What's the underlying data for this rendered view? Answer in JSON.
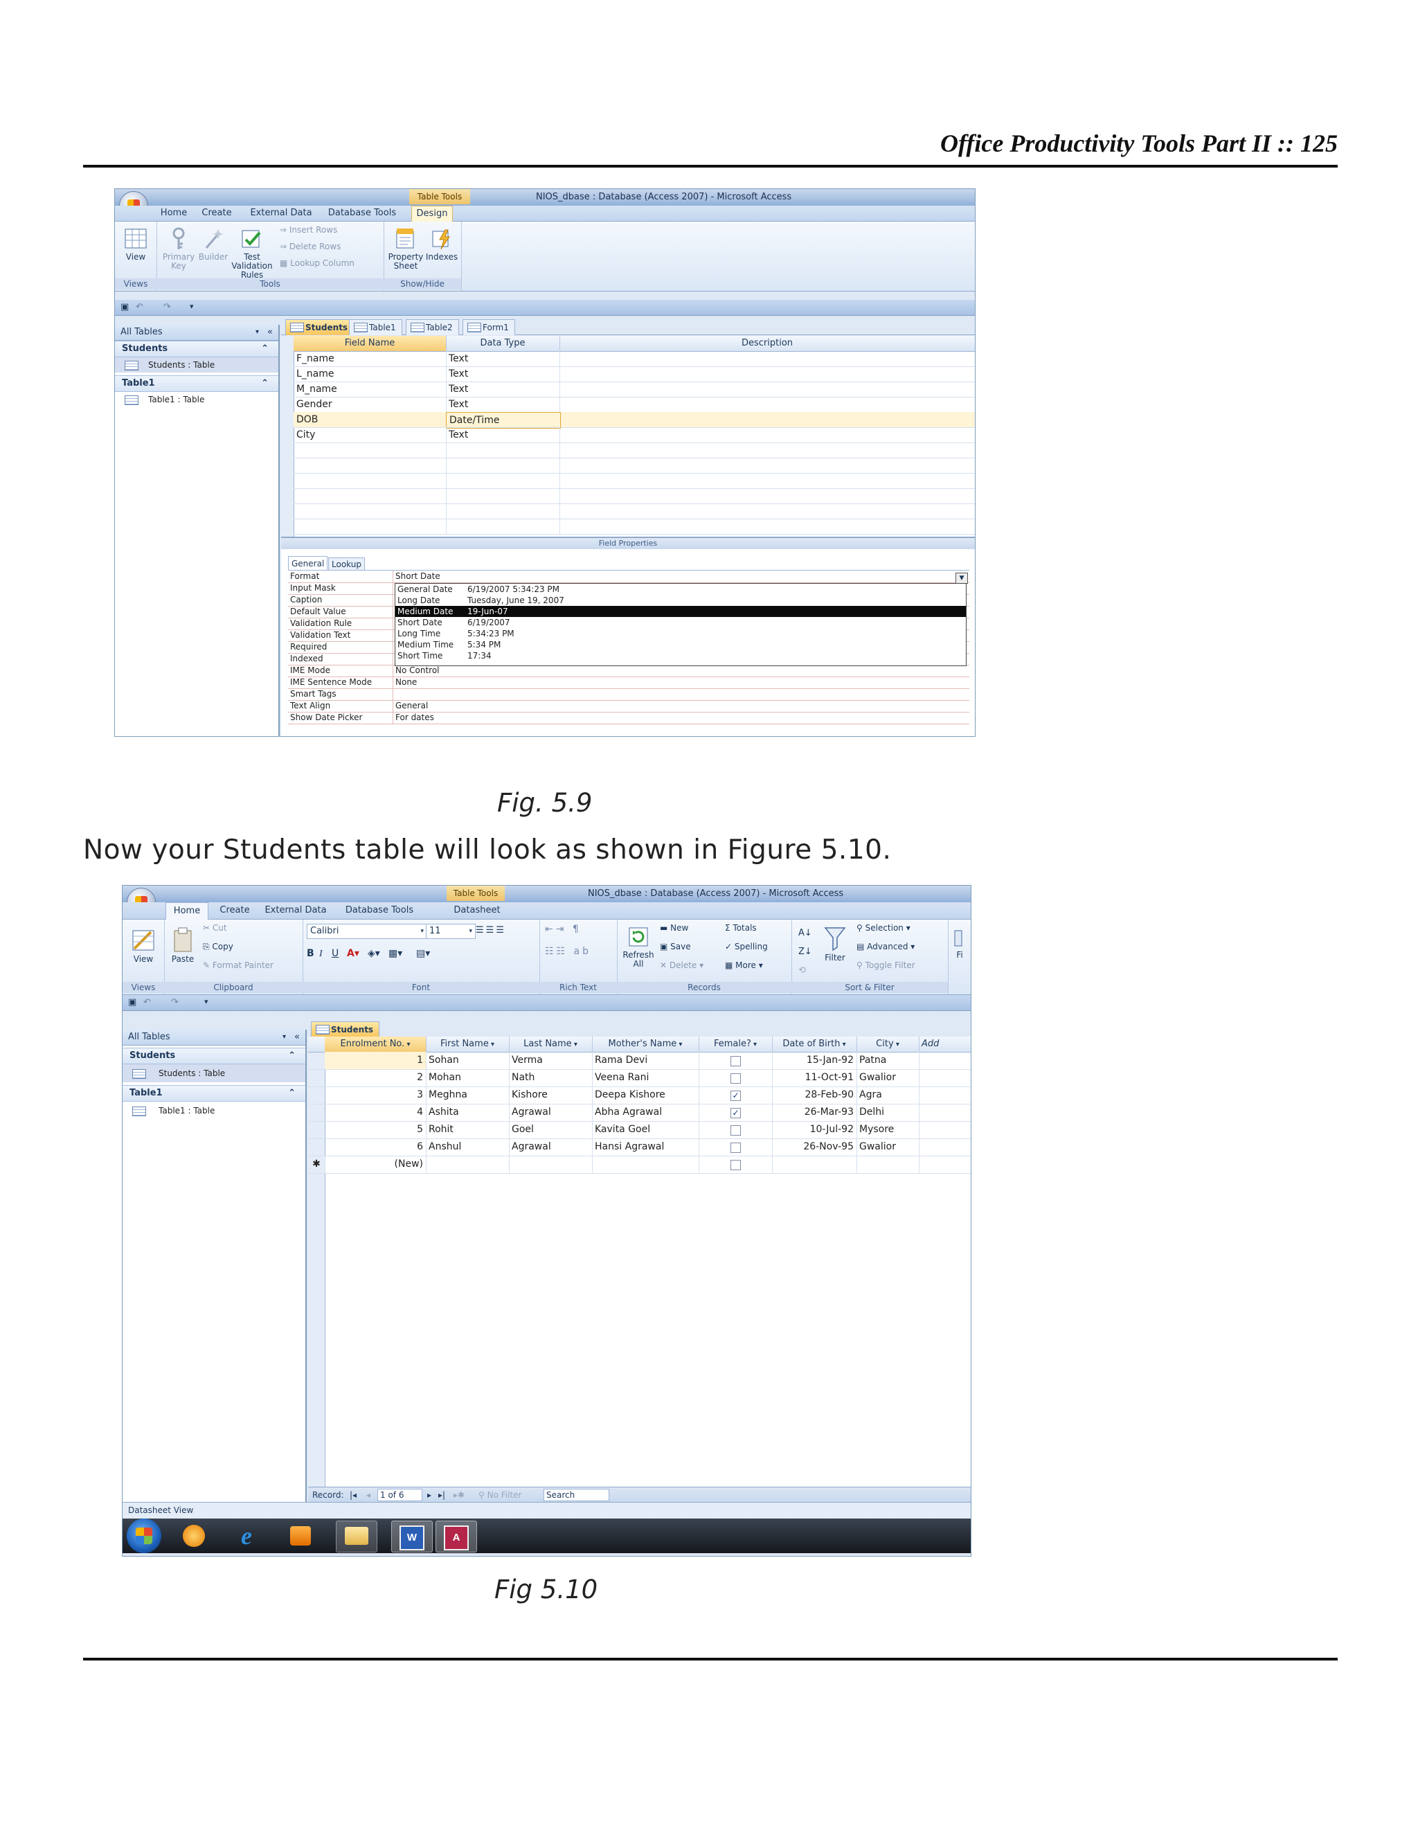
{
  "page": {
    "header": "Office Productivity Tools Part II :: 125",
    "fig1_caption": "Fig. 5.9",
    "body_text": "Now your Students table will look as shown in Figure 5.10.",
    "fig2_caption": "Fig 5.10"
  },
  "fig1": {
    "title": "NIOS_dbase : Database (Access 2007) - Microsoft Access",
    "context_tab": "Table Tools",
    "tabs": [
      "Home",
      "Create",
      "External Data",
      "Database Tools",
      "Design"
    ],
    "ribbon": {
      "view": "View",
      "primary_key": "Primary Key",
      "builder": "Builder",
      "test_rules": "Test Validation Rules",
      "insert_rows": "Insert Rows",
      "delete_rows": "Delete Rows",
      "lookup_column": "Lookup Column",
      "property_sheet": "Property Sheet",
      "indexes": "Indexes",
      "grp_views": "Views",
      "grp_tools": "Tools",
      "grp_showhide": "Show/Hide"
    },
    "nav": {
      "header": "All Tables",
      "groups": [
        {
          "name": "Students",
          "item": "Students : Table"
        },
        {
          "name": "Table1",
          "item": "Table1 : Table"
        }
      ]
    },
    "doc_tabs": [
      "Students",
      "Table1",
      "Table2",
      "Form1"
    ],
    "columns": [
      "Field Name",
      "Data Type",
      "Description"
    ],
    "fields": [
      {
        "name": "F_name",
        "type": "Text"
      },
      {
        "name": "L_name",
        "type": "Text"
      },
      {
        "name": "M_name",
        "type": "Text"
      },
      {
        "name": "Gender",
        "type": "Text"
      },
      {
        "name": "DOB",
        "type": "Date/Time"
      },
      {
        "name": "City",
        "type": "Text"
      }
    ],
    "field_properties_label": "Field Properties",
    "prop_tabs": [
      "General",
      "Lookup"
    ],
    "props": [
      {
        "label": "Format",
        "value": "Short Date"
      },
      {
        "label": "Input Mask",
        "value": ""
      },
      {
        "label": "Caption",
        "value": ""
      },
      {
        "label": "Default Value",
        "value": ""
      },
      {
        "label": "Validation Rule",
        "value": ""
      },
      {
        "label": "Validation Text",
        "value": ""
      },
      {
        "label": "Required",
        "value": ""
      },
      {
        "label": "Indexed",
        "value": ""
      },
      {
        "label": "IME Mode",
        "value": "No Control"
      },
      {
        "label": "IME Sentence Mode",
        "value": "None"
      },
      {
        "label": "Smart Tags",
        "value": ""
      },
      {
        "label": "Text Align",
        "value": "General"
      },
      {
        "label": "Show Date Picker",
        "value": "For dates"
      }
    ],
    "format_options": [
      {
        "name": "General Date",
        "sample": "6/19/2007 5:34:23 PM"
      },
      {
        "name": "Long Date",
        "sample": "Tuesday, June 19, 2007"
      },
      {
        "name": "Medium Date",
        "sample": "19-Jun-07"
      },
      {
        "name": "Short Date",
        "sample": "6/19/2007"
      },
      {
        "name": "Long Time",
        "sample": "5:34:23 PM"
      },
      {
        "name": "Medium Time",
        "sample": "5:34 PM"
      },
      {
        "name": "Short Time",
        "sample": "17:34"
      }
    ],
    "selected_format": "Medium Date"
  },
  "fig2": {
    "title": "NIOS_dbase : Database (Access 2007) - Microsoft Access",
    "context_tab": "Table Tools",
    "tabs": [
      "Home",
      "Create",
      "External Data",
      "Database Tools",
      "Datasheet"
    ],
    "ribbon": {
      "view": "View",
      "paste": "Paste",
      "cut": "Cut",
      "copy": "Copy",
      "format_painter": "Format Painter",
      "font_name": "Calibri",
      "font_size": "11",
      "refresh": "Refresh All",
      "new": "New",
      "save": "Save",
      "delete": "Delete",
      "totals": "Totals",
      "spelling": "Spelling",
      "more": "More",
      "filter": "Filter",
      "selection": "Selection",
      "advanced": "Advanced",
      "toggle_filter": "Toggle Filter",
      "find_trunc": "Fi",
      "grp_views": "Views",
      "grp_clipboard": "Clipboard",
      "grp_font": "Font",
      "grp_richtext": "Rich Text",
      "grp_records": "Records",
      "grp_sortfilter": "Sort & Filter"
    },
    "nav": {
      "header": "All Tables",
      "groups": [
        {
          "name": "Students",
          "item": "Students : Table"
        },
        {
          "name": "Table1",
          "item": "Table1 : Table"
        }
      ]
    },
    "doc_tab": "Students",
    "columns": [
      "Enrolment No.",
      "First Name",
      "Last Name",
      "Mother's Name",
      "Female?",
      "Date of Birth",
      "City",
      "Add"
    ],
    "rows": [
      {
        "no": "1",
        "first": "Sohan",
        "last": "Verma",
        "mother": "Rama Devi",
        "female": false,
        "dob": "15-Jan-92",
        "city": "Patna"
      },
      {
        "no": "2",
        "first": "Mohan",
        "last": "Nath",
        "mother": "Veena Rani",
        "female": false,
        "dob": "11-Oct-91",
        "city": "Gwalior"
      },
      {
        "no": "3",
        "first": "Meghna",
        "last": "Kishore",
        "mother": "Deepa Kishore",
        "female": true,
        "dob": "28-Feb-90",
        "city": "Agra"
      },
      {
        "no": "4",
        "first": "Ashita",
        "last": "Agrawal",
        "mother": "Abha Agrawal",
        "female": true,
        "dob": "26-Mar-93",
        "city": "Delhi"
      },
      {
        "no": "5",
        "first": "Rohit",
        "last": "Goel",
        "mother": "Kavita Goel",
        "female": false,
        "dob": "10-Jul-92",
        "city": "Mysore"
      },
      {
        "no": "6",
        "first": "Anshul",
        "last": "Agrawal",
        "mother": "Hansi Agrawal",
        "female": false,
        "dob": "26-Nov-95",
        "city": "Gwalior"
      }
    ],
    "new_row": "(New)",
    "record_label": "Record:",
    "record_pos": "1 of 6",
    "no_filter": "No Filter",
    "search": "Search",
    "status": "Datasheet View"
  }
}
